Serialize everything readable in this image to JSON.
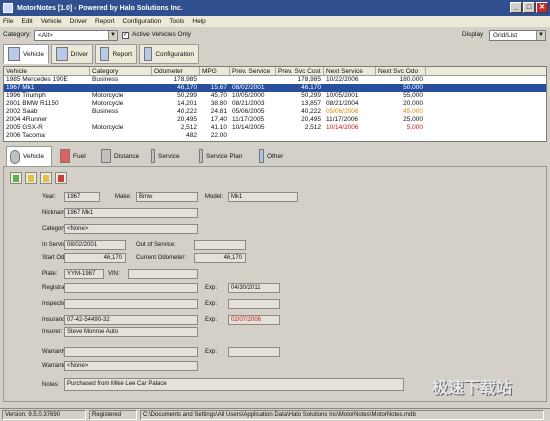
{
  "window": {
    "title": "MotorNotes [1.0] - Powered by Halo Solutions Inc.",
    "min_glyph": "_",
    "max_glyph": "□",
    "close_glyph": "✕"
  },
  "menu": [
    "File",
    "Edit",
    "Vehicle",
    "Driver",
    "Report",
    "Configuration",
    "Tools",
    "Help"
  ],
  "filter": {
    "category_label": "Category:",
    "category_value": "<All>",
    "active_only_label": "Active Vehicles Only",
    "active_only_checked": "✓",
    "display_label": "Display",
    "display_value": "Grid/List"
  },
  "top_tabs": [
    {
      "label": "Vehicle"
    },
    {
      "label": "Driver"
    },
    {
      "label": "Report"
    },
    {
      "label": "Configuration"
    }
  ],
  "grid": {
    "headers": [
      "Vehicle",
      "Category",
      "Odometer",
      "MPG",
      "Prev. Service",
      "Prev. Svc Cost",
      "Next Service",
      "Next Svc Odo"
    ],
    "rows": [
      {
        "vehicle": "1985 Mercedes 190E",
        "category": "Business",
        "odometer": "178,985",
        "mpg": "",
        "prev_service": "",
        "prev_cost": "178,985",
        "next_service": "10/22/2006",
        "next_odo": "180,000",
        "selected": false,
        "next_color": ""
      },
      {
        "vehicle": "1967 Mk1",
        "category": "",
        "odometer": "46,170",
        "mpg": "15.67",
        "prev_service": "08/02/2001",
        "prev_cost": "46,170",
        "next_service": "",
        "next_odo": "50,000",
        "selected": true,
        "next_color": ""
      },
      {
        "vehicle": "1996 Triumph",
        "category": "Motorcycle",
        "odometer": "50,299",
        "mpg": "45.70",
        "prev_service": "10/05/2000",
        "prev_cost": "50,299",
        "next_service": "10/05/2001",
        "next_odo": "55,000",
        "selected": false,
        "next_color": ""
      },
      {
        "vehicle": "2001 BMW R1150",
        "category": "Motorcycle",
        "odometer": "14,201",
        "mpg": "38.80",
        "prev_service": "08/21/2003",
        "prev_cost": "13,857",
        "next_service": "08/21/2004",
        "next_odo": "20,000",
        "selected": false,
        "next_color": ""
      },
      {
        "vehicle": "2002 Saab",
        "category": "Business",
        "odometer": "40,222",
        "mpg": "24.81",
        "prev_service": "05/06/2005",
        "prev_cost": "40,222",
        "next_service": "05/06/2006",
        "next_odo": "45,000",
        "selected": false,
        "next_color": "orange"
      },
      {
        "vehicle": "2004 4Runner",
        "category": "",
        "odometer": "20,495",
        "mpg": "17.40",
        "prev_service": "11/17/2005",
        "prev_cost": "20,495",
        "next_service": "11/17/2006",
        "next_odo": "25,000",
        "selected": false,
        "next_color": ""
      },
      {
        "vehicle": "2005 GSX-R",
        "category": "Motorcycle",
        "odometer": "2,512",
        "mpg": "41.10",
        "prev_service": "10/14/2005",
        "prev_cost": "2,512",
        "next_service": "10/14/2006",
        "next_odo": "5,000",
        "selected": false,
        "next_color": "red"
      },
      {
        "vehicle": "2006 Tacoma",
        "category": "",
        "odometer": "482",
        "mpg": "22.00",
        "prev_service": "",
        "prev_cost": "",
        "next_service": "",
        "next_odo": "",
        "selected": false,
        "next_color": ""
      }
    ]
  },
  "mid_tabs": [
    {
      "label": "Vehicle"
    },
    {
      "label": "Fuel"
    },
    {
      "label": "Distance"
    },
    {
      "label": "Service"
    },
    {
      "label": "Service Plan"
    },
    {
      "label": "Other"
    }
  ],
  "details": {
    "year_label": "Year:",
    "year": "1967",
    "make_label": "Make:",
    "make": "Bmw",
    "model_label": "Model:",
    "model": "Mk1",
    "nickname_label": "Nickname:",
    "nickname": "1967 Mk1",
    "category_label": "Category:",
    "category": "<None>",
    "in_service_label": "In Service:",
    "in_service": "08/02/2001",
    "out_service_label": "Out of Service:",
    "out_service": "",
    "start_odo_label": "Start Odometer:",
    "start_odo": "46,170",
    "current_odo_label": "Current Odometer:",
    "current_odo": "46,170",
    "plate_label": "Plate:",
    "plate": "YYM-1987",
    "vin_label": "VIN:",
    "vin": "",
    "registration_label": "Registration:",
    "registration": "",
    "registration_exp_label": "Exp:",
    "registration_exp": "04/30/2011",
    "inspection_label": "Inspection:",
    "inspection": "",
    "inspection_exp_label": "Exp:",
    "inspection_exp": "",
    "insurance_label": "Insurance:",
    "insurance": "07-42-54490-32",
    "insurance_exp_label": "Exp:",
    "insurance_exp": "02/07/2006",
    "insurer_label": "Insurer:",
    "insurer": "Steve Monroe Auto",
    "warranty_label": "Warranty:",
    "warranty": "",
    "warranty_exp_label": "Exp:",
    "warranty_exp": "",
    "warrantor_label": "Warrantor:",
    "warrantor": "<None>",
    "notes_label": "Notes:",
    "notes": "Purchased from Mike Lee Car Palace"
  },
  "status": {
    "version": "Version: 9.5.0.37690",
    "registered": "Registered",
    "path": "C:\\Documents and Settings\\All Users\\Application Data\\Halo Solutions Inc\\MotorNotes\\MotorNotes.mdb"
  },
  "watermark": "极速下载站",
  "colors": {
    "title_bg": "#2f4f8f",
    "selection": "#2a4f9e",
    "overdue": "#c01818",
    "due_soon": "#d98a00"
  }
}
